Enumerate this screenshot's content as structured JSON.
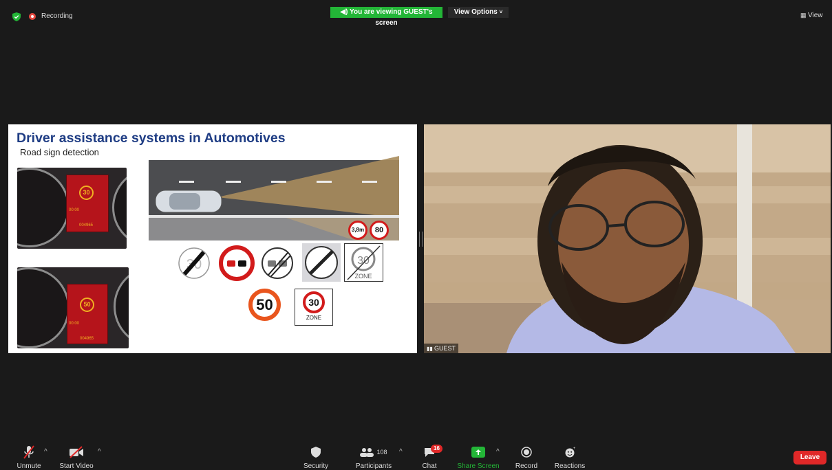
{
  "top_bar": {
    "recording_label": "Recording",
    "viewing_banner": "You are viewing GUEST's screen",
    "view_options_label": "View Options",
    "view_label": "View",
    "colors": {
      "banner": "#23b637",
      "recording": "#e5483f"
    }
  },
  "slide": {
    "title": "Driver assistance systems in Automotives",
    "subtitle": "Road sign detection",
    "dash1": {
      "limit": "30",
      "time": "00:00",
      "odometer": "004965"
    },
    "dash2": {
      "limit": "50",
      "time": "00:00",
      "odometer": "004965"
    },
    "road_sign_height": "3,8m",
    "road_sign_limit": "80",
    "sign_30": "30",
    "sign_zone": "ZONE",
    "sign_50": "50"
  },
  "video": {
    "participant_name": "GUEST"
  },
  "toolbar": {
    "unmute": "Unmute",
    "start_video": "Start Video",
    "security": "Security",
    "participants": "Participants",
    "participant_count": "108",
    "chat": "Chat",
    "chat_badge": "16",
    "share_screen": "Share Screen",
    "record": "Record",
    "reactions": "Reactions",
    "leave": "Leave",
    "colors": {
      "share": "#23b637",
      "leave": "#e02828",
      "badge": "#e02828"
    }
  }
}
